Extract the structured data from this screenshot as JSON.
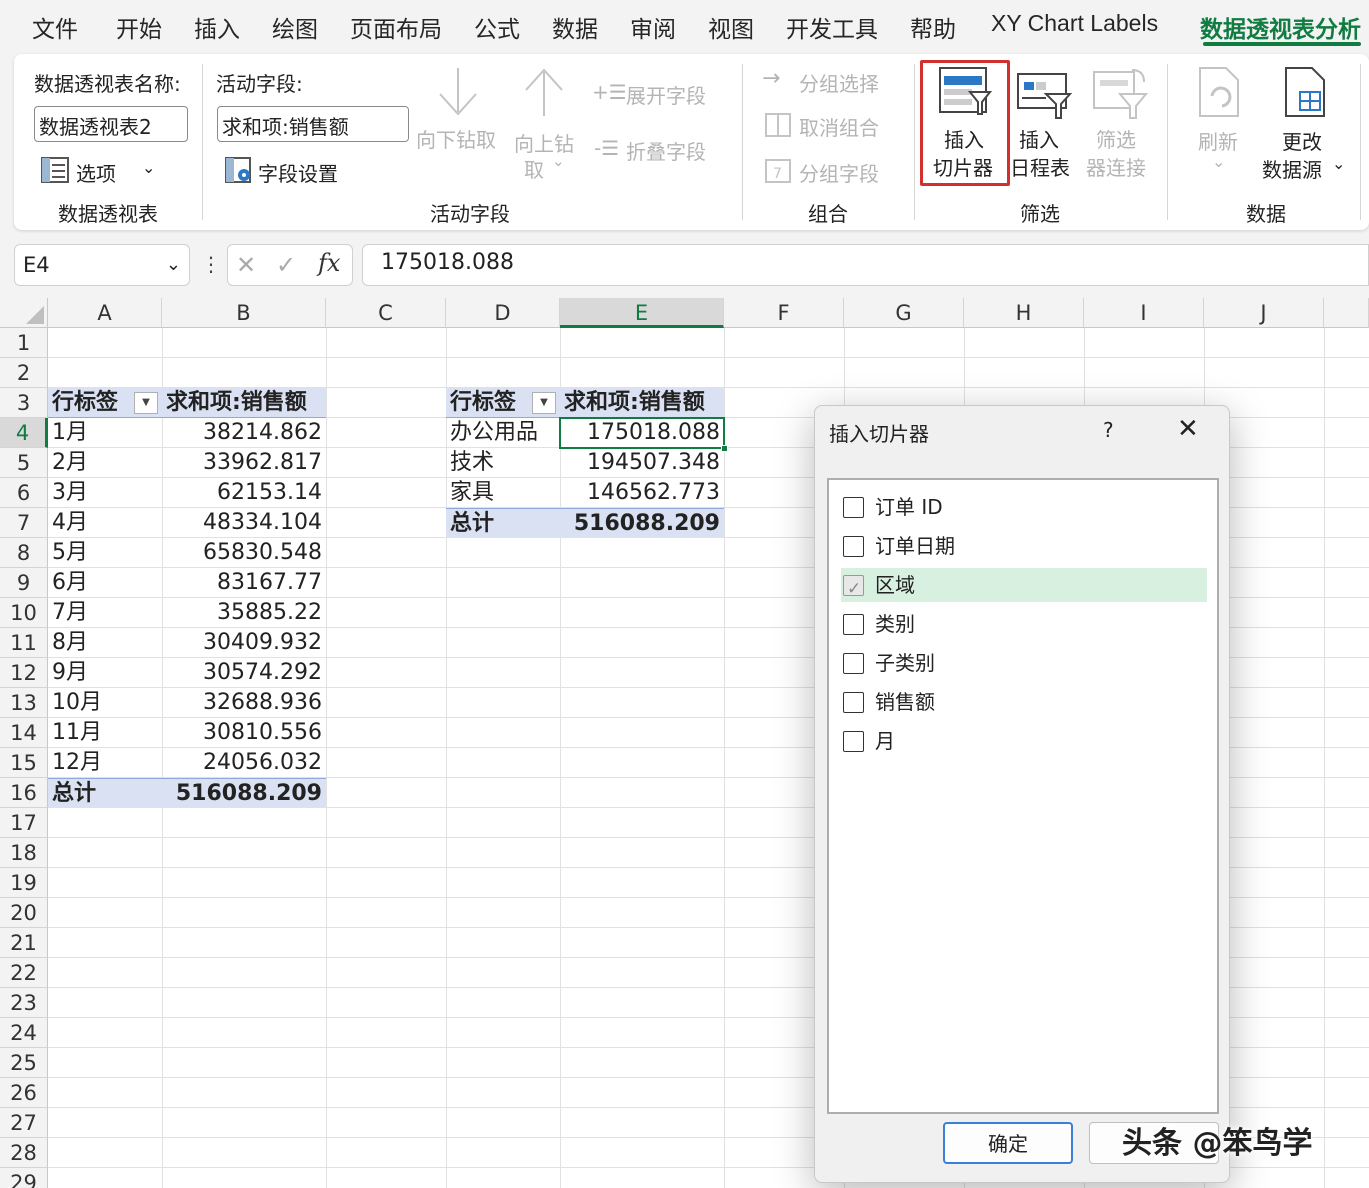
{
  "tabs": [
    "文件",
    "开始",
    "插入",
    "绘图",
    "页面布局",
    "公式",
    "数据",
    "审阅",
    "视图",
    "开发工具",
    "帮助",
    "XY Chart Labels",
    "数据透视表分析"
  ],
  "ribbon": {
    "pivot_name_label": "数据透视表名称:",
    "pivot_name_value": "数据透视表2",
    "options_label": "选项",
    "group_pivot": "数据透视表",
    "active_field_label": "活动字段:",
    "active_field_value": "求和项:销售额",
    "field_settings": "字段设置",
    "drill_down": "向下钻取",
    "drill_up_1": "向上钻",
    "drill_up_2": "取",
    "expand_field": "展开字段",
    "collapse_field": "折叠字段",
    "group_active_field": "活动字段",
    "group_selection": "分组选择",
    "ungroup": "取消组合",
    "group_field": "分组字段",
    "group_group": "组合",
    "insert_slicer_1": "插入",
    "insert_slicer_2": "切片器",
    "insert_timeline_1": "插入",
    "insert_timeline_2": "日程表",
    "filter_conn_1": "筛选",
    "filter_conn_2": "器连接",
    "group_filter": "筛选",
    "refresh": "刷新",
    "change_source_1": "更改",
    "change_source_2": "数据源",
    "group_data": "数据"
  },
  "formula_bar": {
    "name_box": "E4",
    "fx": "fx",
    "value": "175018.088"
  },
  "grid": {
    "columns": [
      "A",
      "B",
      "C",
      "D",
      "E",
      "F",
      "G",
      "H",
      "I",
      "J"
    ],
    "rows": [
      "1",
      "2",
      "3",
      "4",
      "5",
      "6",
      "7",
      "8",
      "9",
      "10",
      "11",
      "12",
      "13",
      "14",
      "15",
      "16",
      "17",
      "18",
      "19",
      "20",
      "21",
      "22",
      "23",
      "24",
      "25",
      "26",
      "27",
      "28",
      "29"
    ],
    "pivot1": {
      "header_label": "行标签",
      "header_value": "求和项:销售额",
      "rows": [
        {
          "label": "1月",
          "value": "38214.862"
        },
        {
          "label": "2月",
          "value": "33962.817"
        },
        {
          "label": "3月",
          "value": "62153.14"
        },
        {
          "label": "4月",
          "value": "48334.104"
        },
        {
          "label": "5月",
          "value": "65830.548"
        },
        {
          "label": "6月",
          "value": "83167.77"
        },
        {
          "label": "7月",
          "value": "35885.22"
        },
        {
          "label": "8月",
          "value": "30409.932"
        },
        {
          "label": "9月",
          "value": "30574.292"
        },
        {
          "label": "10月",
          "value": "32688.936"
        },
        {
          "label": "11月",
          "value": "30810.556"
        },
        {
          "label": "12月",
          "value": "24056.032"
        }
      ],
      "total_label": "总计",
      "total_value": "516088.209"
    },
    "pivot2": {
      "header_label": "行标签",
      "header_value": "求和项:销售额",
      "rows": [
        {
          "label": "办公用品",
          "value": "175018.088"
        },
        {
          "label": "技术",
          "value": "194507.348"
        },
        {
          "label": "家具",
          "value": "146562.773"
        }
      ],
      "total_label": "总计",
      "total_value": "516088.209"
    }
  },
  "dialog": {
    "title": "插入切片器",
    "help": "?",
    "close": "✕",
    "fields": [
      {
        "label": "订单 ID",
        "checked": false
      },
      {
        "label": "订单日期",
        "checked": false
      },
      {
        "label": "区域",
        "checked": true
      },
      {
        "label": "类别",
        "checked": false
      },
      {
        "label": "子类别",
        "checked": false
      },
      {
        "label": "销售额",
        "checked": false
      },
      {
        "label": "月",
        "checked": false
      }
    ],
    "ok": "确定",
    "cancel": ""
  },
  "watermark": "头条 @笨鸟学",
  "colors": {
    "accent": "#107c41",
    "pivot_header": "#d9e1f2",
    "highlight": "#d32f2f"
  }
}
